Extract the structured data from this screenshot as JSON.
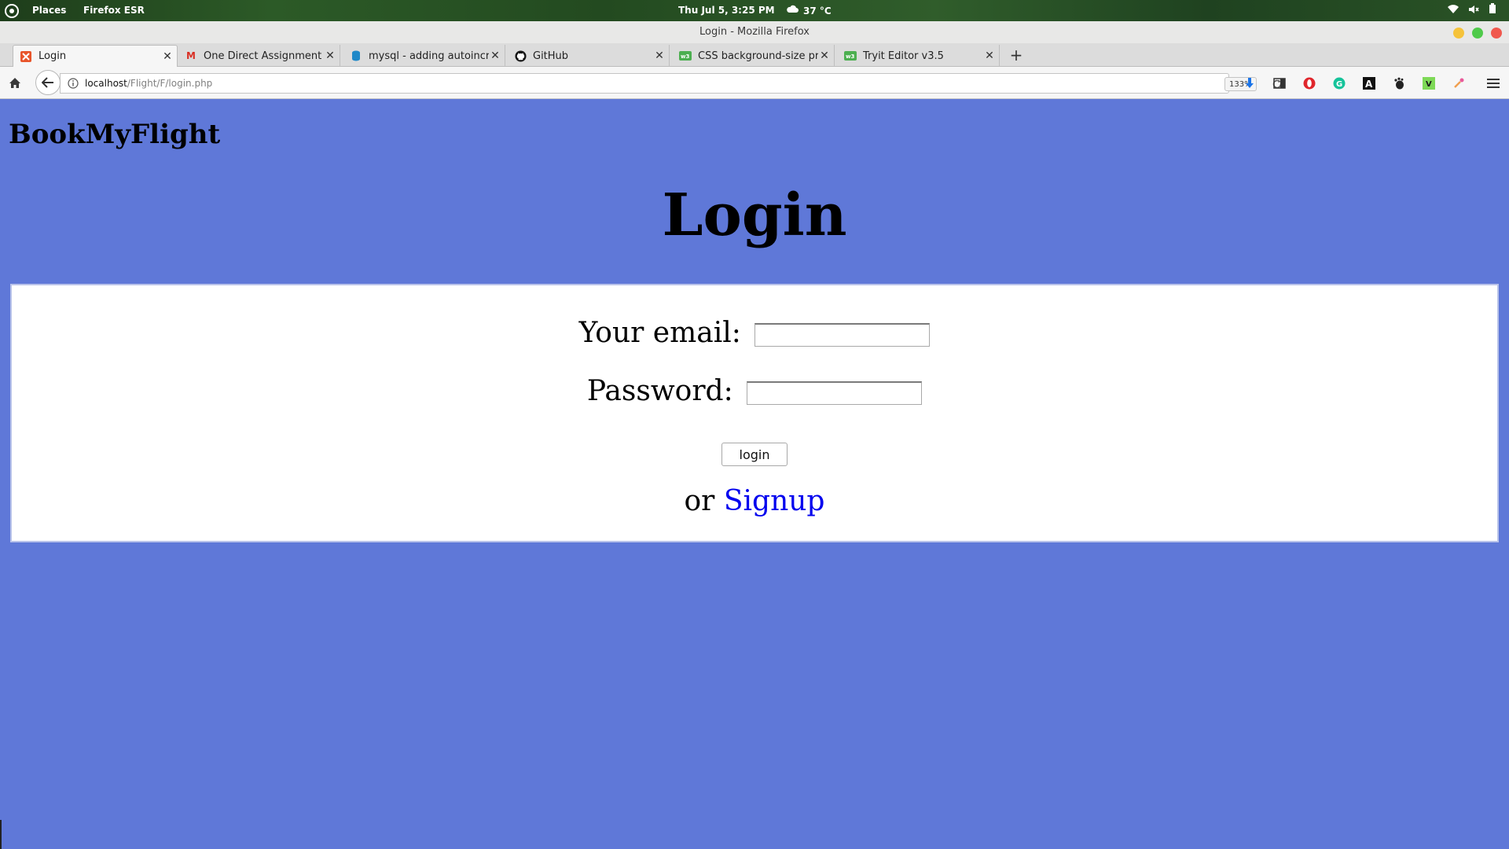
{
  "topbar": {
    "places": "Places",
    "app": "Firefox ESR",
    "clock": "Thu Jul  5,  3:25 PM",
    "temperature": "37 °C"
  },
  "window": {
    "title": "Login - Mozilla Firefox"
  },
  "tabs": [
    {
      "label": "Login",
      "icon": "xampp-icon",
      "color": "#e8552b"
    },
    {
      "label": "One Direct Assignment t...",
      "icon": "gmail-icon",
      "color": "#d93025"
    },
    {
      "label": "mysql - adding autoincre...",
      "icon": "database-icon",
      "color": "#1e88c8"
    },
    {
      "label": "GitHub",
      "icon": "github-icon",
      "color": "#111111"
    },
    {
      "label": "CSS background-size pro...",
      "icon": "w3schools-icon",
      "color": "#4caf50"
    },
    {
      "label": "Tryit Editor v3.5",
      "icon": "w3schools-icon",
      "color": "#4caf50"
    }
  ],
  "nav": {
    "url_host": "localhost",
    "url_path": "/Flight/F/login.php",
    "zoom": "133%"
  },
  "page": {
    "brand": "BookMyFlight",
    "title": "Login",
    "email_label": "Your email:",
    "password_label": "Password:",
    "login_button": "login",
    "or_text": "or",
    "signup_link": "Signup",
    "background_color": "#5f78d8"
  }
}
